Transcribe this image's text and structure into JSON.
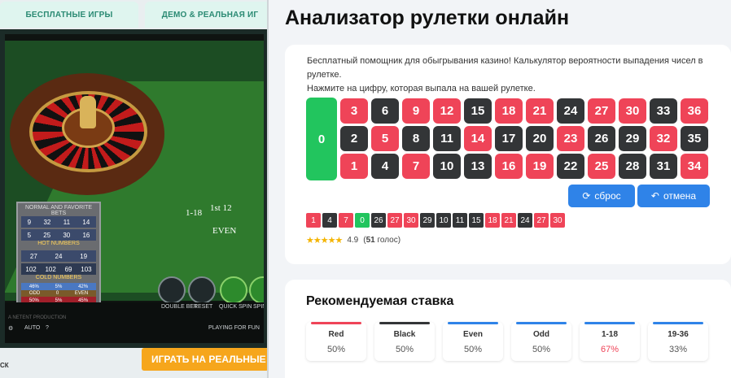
{
  "left_panel": {
    "tabs": [
      "БЕСПЛАТНЫЕ ИГРЫ",
      "ДЕМО & РЕАЛЬНАЯ ИГ"
    ],
    "cta_label": "ИГРАТЬ НА РЕАЛЬНЫЕ Д",
    "cut_label": "СК",
    "game": {
      "table_labels": [
        "1-18",
        "EVEN",
        "1st 12"
      ],
      "stats_panel": {
        "header": "NORMAL AND FAVORITE BETS",
        "hot_title": "HOT NUMBERS",
        "cold_title": "COLD NUMBERS",
        "row1": [
          "9",
          "32",
          "11",
          "14"
        ],
        "row2": [
          "5",
          "25",
          "30",
          "16"
        ],
        "row3": [
          "27",
          "24",
          "19"
        ],
        "row4": [
          "102",
          "102",
          "69",
          "103"
        ],
        "pct1": [
          "46%",
          "5%",
          "42%"
        ],
        "odd_even": [
          "ODD",
          "0",
          "EVEN"
        ],
        "pct2": [
          "50%",
          "5%",
          "45%"
        ]
      },
      "buttons": [
        "DOUBLE BET",
        "RESET",
        "QUICK SPIN",
        "SPIN"
      ],
      "bottom_text": "PLAYING FOR FUN",
      "auto_label": "AUTO",
      "help_label": "?",
      "credit_text": "A NETENT PRODUCTION"
    }
  },
  "analyzer": {
    "title": "Анализатор рулетки онлайн",
    "description": "Бесплатный помощник для обыгрывания казино! Калькулятор вероятности выпадения чисел в рулетке.",
    "instruction": "Нажмите на цифру, которая выпала на вашей рулетке.",
    "zero": "0",
    "rows": [
      [
        {
          "n": "3",
          "c": "red"
        },
        {
          "n": "6",
          "c": "black"
        },
        {
          "n": "9",
          "c": "red"
        },
        {
          "n": "12",
          "c": "red"
        },
        {
          "n": "15",
          "c": "black"
        },
        {
          "n": "18",
          "c": "red"
        },
        {
          "n": "21",
          "c": "red"
        },
        {
          "n": "24",
          "c": "black"
        },
        {
          "n": "27",
          "c": "red"
        },
        {
          "n": "30",
          "c": "red"
        },
        {
          "n": "33",
          "c": "black"
        },
        {
          "n": "36",
          "c": "red"
        }
      ],
      [
        {
          "n": "2",
          "c": "black"
        },
        {
          "n": "5",
          "c": "red"
        },
        {
          "n": "8",
          "c": "black"
        },
        {
          "n": "11",
          "c": "black"
        },
        {
          "n": "14",
          "c": "red"
        },
        {
          "n": "17",
          "c": "black"
        },
        {
          "n": "20",
          "c": "black"
        },
        {
          "n": "23",
          "c": "red"
        },
        {
          "n": "26",
          "c": "black"
        },
        {
          "n": "29",
          "c": "black"
        },
        {
          "n": "32",
          "c": "red"
        },
        {
          "n": "35",
          "c": "black"
        }
      ],
      [
        {
          "n": "1",
          "c": "red"
        },
        {
          "n": "4",
          "c": "black"
        },
        {
          "n": "7",
          "c": "red"
        },
        {
          "n": "10",
          "c": "black"
        },
        {
          "n": "13",
          "c": "black"
        },
        {
          "n": "16",
          "c": "red"
        },
        {
          "n": "19",
          "c": "red"
        },
        {
          "n": "22",
          "c": "black"
        },
        {
          "n": "25",
          "c": "red"
        },
        {
          "n": "28",
          "c": "black"
        },
        {
          "n": "31",
          "c": "black"
        },
        {
          "n": "34",
          "c": "red"
        }
      ]
    ],
    "reset_label": "сброс",
    "undo_label": "отмена",
    "history": [
      {
        "n": "1",
        "c": "red"
      },
      {
        "n": "4",
        "c": "black"
      },
      {
        "n": "7",
        "c": "red"
      },
      {
        "n": "0",
        "c": "green"
      },
      {
        "n": "26",
        "c": "black"
      },
      {
        "n": "27",
        "c": "red"
      },
      {
        "n": "30",
        "c": "red"
      },
      {
        "n": "29",
        "c": "black"
      },
      {
        "n": "10",
        "c": "black"
      },
      {
        "n": "11",
        "c": "black"
      },
      {
        "n": "15",
        "c": "black"
      },
      {
        "n": "18",
        "c": "red"
      },
      {
        "n": "21",
        "c": "red"
      },
      {
        "n": "24",
        "c": "black"
      },
      {
        "n": "27",
        "c": "red"
      },
      {
        "n": "30",
        "c": "red"
      }
    ],
    "rating": {
      "stars": "★★★★★",
      "score": "4.9",
      "votes_count": "51",
      "votes_word": "голос"
    }
  },
  "recommended": {
    "title": "Рекомендуемая ставка",
    "bets": [
      {
        "name": "Red",
        "value": "50%",
        "bar": "#ef4458",
        "hot": false
      },
      {
        "name": "Black",
        "value": "50%",
        "bar": "#333537",
        "hot": false
      },
      {
        "name": "Even",
        "value": "50%",
        "bar": "#2f83e8",
        "hot": false
      },
      {
        "name": "Odd",
        "value": "50%",
        "bar": "#2f83e8",
        "hot": false
      },
      {
        "name": "1-18",
        "value": "67%",
        "bar": "#2f83e8",
        "hot": true
      },
      {
        "name": "19-36",
        "value": "33%",
        "bar": "#2f83e8",
        "hot": false
      }
    ]
  },
  "colors": {
    "red": "#ef4458",
    "black": "#333537",
    "green": "#22c55e",
    "blue": "#2f83e8"
  }
}
